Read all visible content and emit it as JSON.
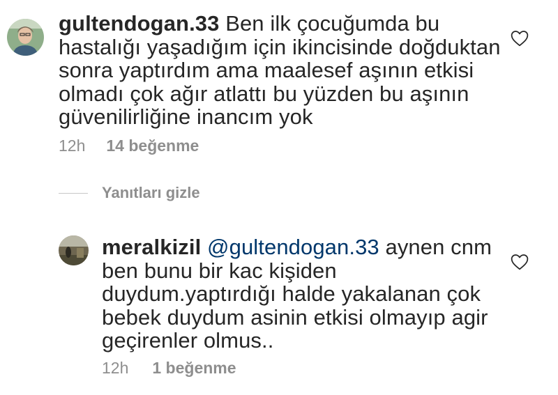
{
  "comments": [
    {
      "username": "gultendogan.33",
      "mention": "",
      "text": "Ben ilk çocuğumda bu hastalığı yaşadığım için ikincisinde doğduktan sonra yaptırdım ama maalesef aşının etkisi olmadı çok ağır atlattı bu yüzden bu aşının güvenilirliğine inancım yok",
      "time": "12h",
      "likes": "14 beğenme"
    },
    {
      "username": "meralkizil",
      "mention": "@gultendogan.33",
      "text": "aynen cnm ben bunu bir kac kişiden duydum.yaptırdığı halde yakalanan çok bebek duydum asinin etkisi olmayıp agir geçirenler olmus..",
      "time": "12h",
      "likes": "1 beğenme"
    }
  ],
  "replies_toggle": {
    "label": "Yanıtları gizle"
  },
  "icons": {
    "like": "heart-outline-icon"
  },
  "colors": {
    "text": "#262626",
    "meta": "#8e8e8e",
    "mention": "#00376b"
  }
}
